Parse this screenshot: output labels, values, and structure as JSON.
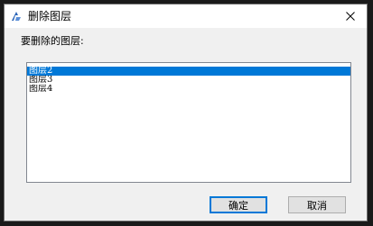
{
  "window": {
    "title": "删除图层",
    "app_icon": "cad-app-icon",
    "close_icon": "close-icon"
  },
  "prompt": "要删除的图层:",
  "layers": [
    "图层2",
    "图层3",
    "图层4"
  ],
  "selected_index": 0,
  "buttons": {
    "ok": "确定",
    "cancel": "取消"
  },
  "colors": {
    "selection": "#0078d7",
    "accent_border": "#0078d7"
  }
}
